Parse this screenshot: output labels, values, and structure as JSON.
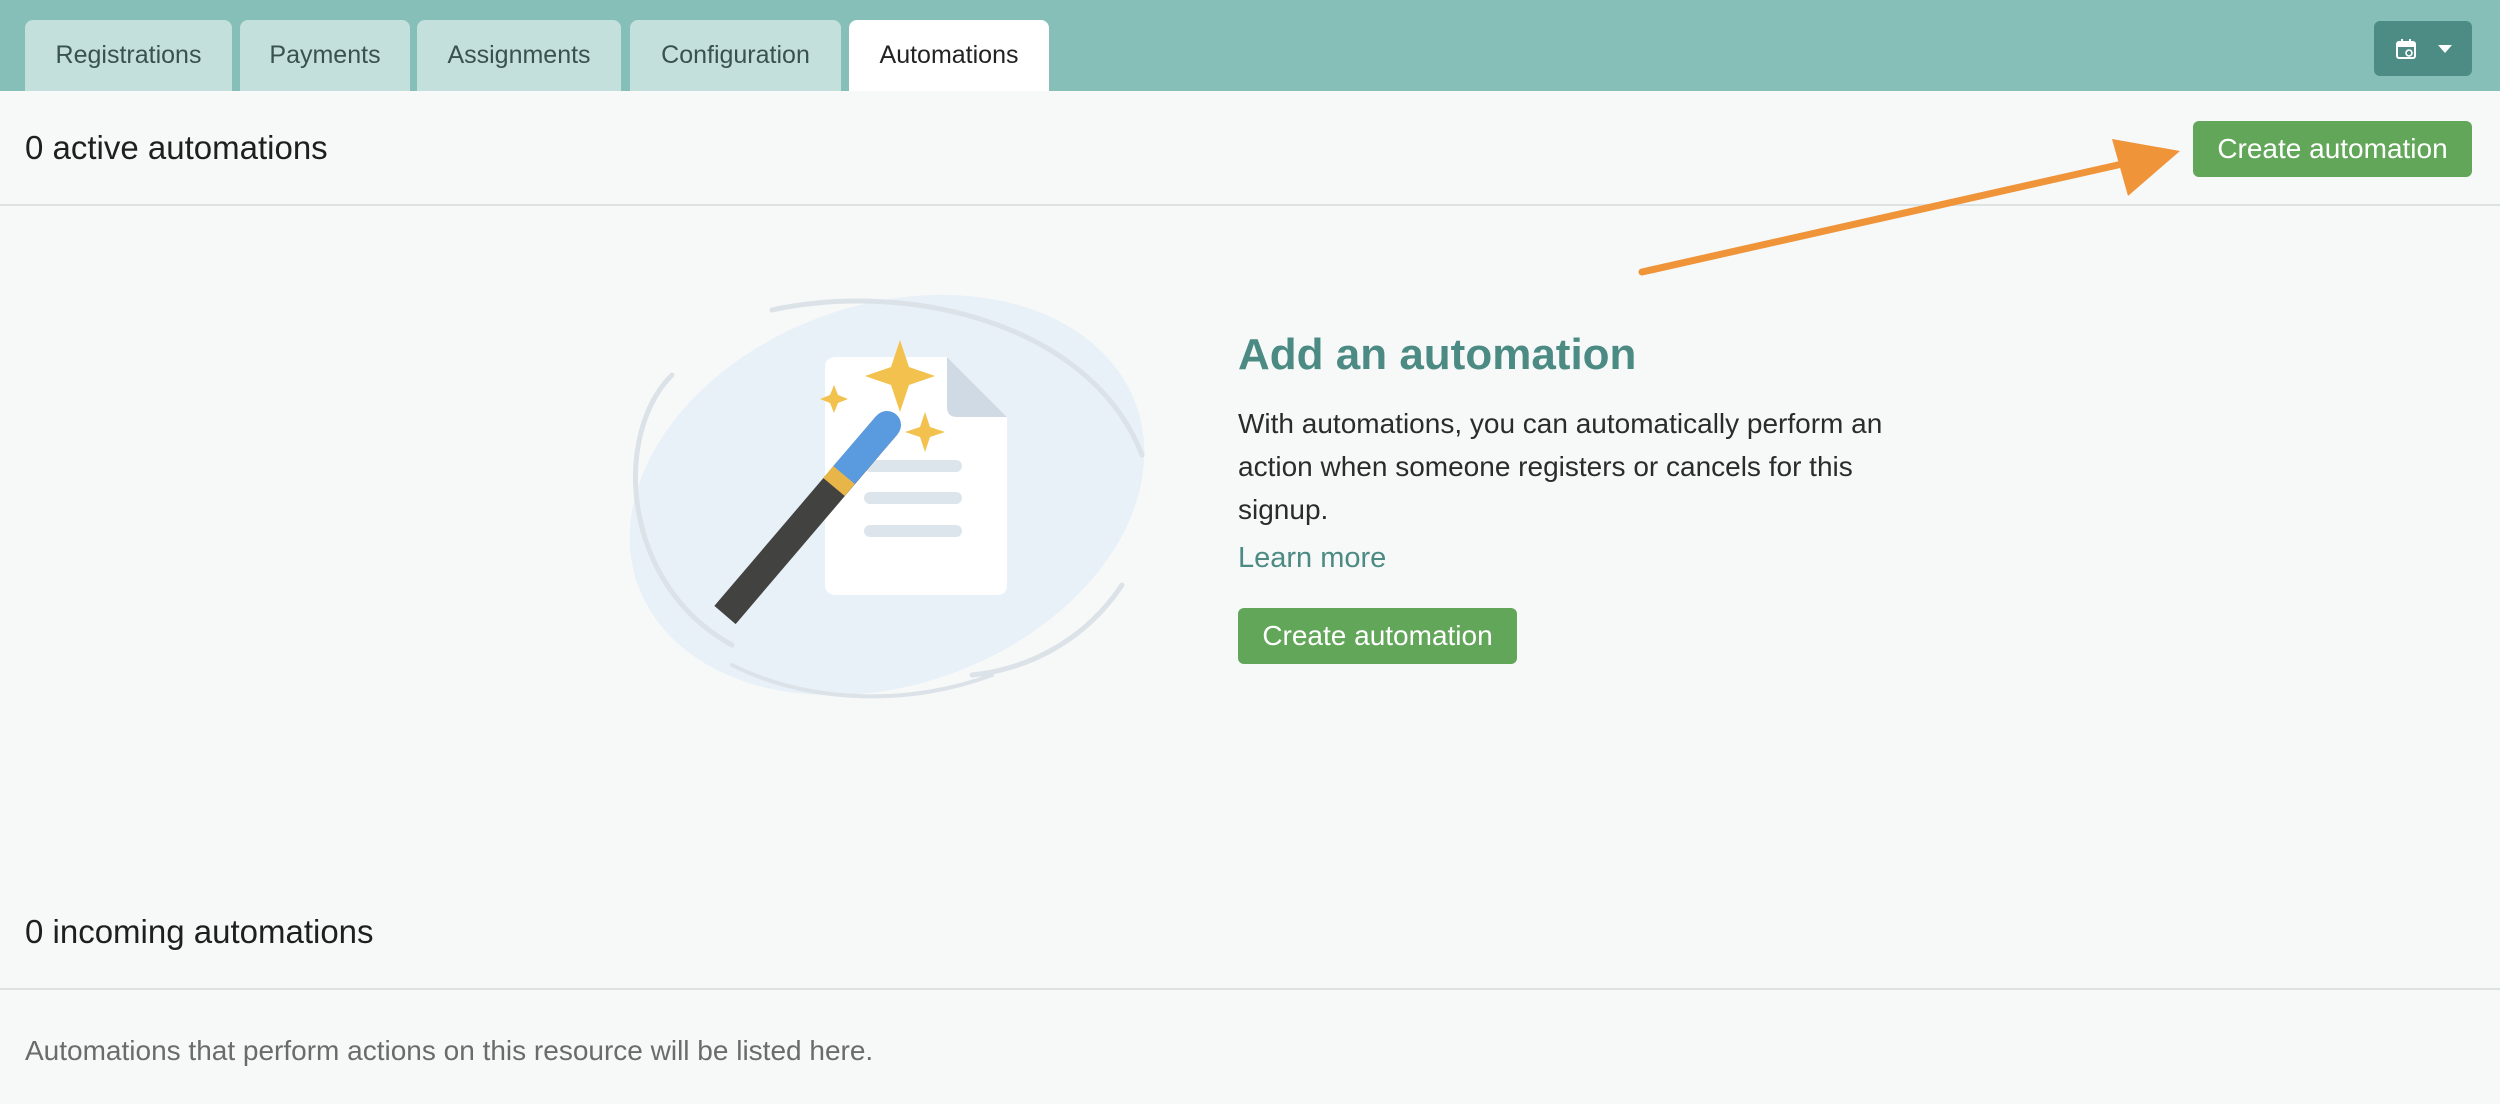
{
  "tabs": [
    {
      "label": "Registrations"
    },
    {
      "label": "Payments"
    },
    {
      "label": "Assignments"
    },
    {
      "label": "Configuration"
    },
    {
      "label": "Automations",
      "active": true
    }
  ],
  "toolbar": {
    "calendar_icon": "calendar-sync-icon",
    "dropdown_icon": "caret-down-icon"
  },
  "active": {
    "count_label": "0 active automations",
    "create_button": "Create automation"
  },
  "empty_state": {
    "illustration_icon": "magic-wand-document-icon",
    "title": "Add an automation",
    "description": "With automations, you can automatically perform an action when someone registers or cancels for this signup.",
    "learn_more": "Learn more",
    "create_button": "Create automation"
  },
  "incoming": {
    "count_label": "0 incoming automations",
    "description": "Automations that perform actions on this resource will be listed here."
  },
  "colors": {
    "tabbar": "#86bfb8",
    "accent_green": "#62a659",
    "teal_text": "#4c8a84",
    "annotation_arrow": "#ef9439"
  }
}
